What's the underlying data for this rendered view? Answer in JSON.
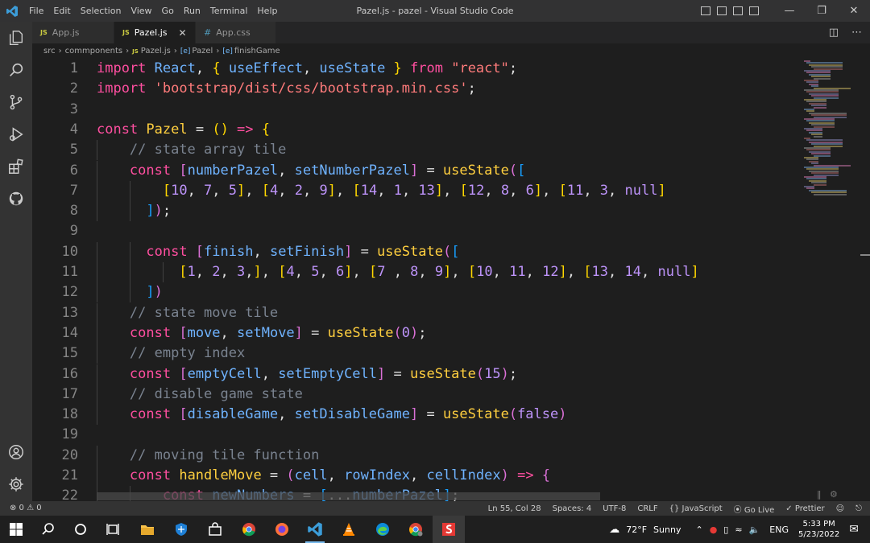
{
  "titlebar": {
    "menu": [
      "File",
      "Edit",
      "Selection",
      "View",
      "Go",
      "Run",
      "Terminal",
      "Help"
    ],
    "window_title": "Pazel.js - pazel - Visual Studio Code"
  },
  "tabs": [
    {
      "lang": "JS",
      "label": "App.js",
      "active": false
    },
    {
      "lang": "JS",
      "label": "Pazel.js",
      "active": true
    },
    {
      "lang": "#",
      "label": "App.css",
      "active": false
    }
  ],
  "breadcrumb": {
    "folder1": "src",
    "folder2": "commponents",
    "file_lang": "JS",
    "file": "Pazel.js",
    "symbol1_icon": "[e]",
    "symbol1": "Pazel",
    "symbol2_icon": "[e]",
    "symbol2": "finishGame"
  },
  "code": {
    "line_numbers": [
      "1",
      "2",
      "3",
      "4",
      "5",
      "6",
      "7",
      "8",
      "9",
      "10",
      "11",
      "12",
      "13",
      "14",
      "15",
      "16",
      "17",
      "18",
      "19",
      "20",
      "21",
      "22"
    ]
  },
  "statusbar": {
    "errors": "⊗ 0 ⚠ 0",
    "position": "Ln 55, Col 28",
    "spaces": "Spaces: 4",
    "encoding": "UTF-8",
    "eol": "CRLF",
    "language": "{} JavaScript",
    "golive": "⦿ Go Live",
    "prettier": "✓ Prettier"
  },
  "taskbar": {
    "weather_temp": "72°F",
    "weather_desc": "Sunny",
    "language": "ENG",
    "time": "5:33 PM",
    "date": "5/23/2022"
  },
  "colors": {
    "keyword": "#ff4fa0",
    "function": "#ffcf3f",
    "identifier": "#6fb3ff",
    "string": "#ff7b7b",
    "number": "#bd93f9",
    "comment": "#7a8390"
  }
}
